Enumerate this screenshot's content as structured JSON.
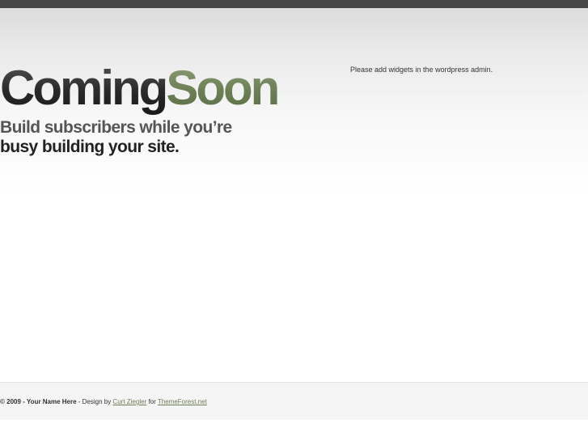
{
  "header": {
    "logo_part1": "Coming",
    "logo_part2": "Soon",
    "tagline_line1": "Build subscribers while you’re",
    "tagline_line2": "busy building your site."
  },
  "sidebar": {
    "widget_note": "Please add widgets in the wordpress admin."
  },
  "footer": {
    "copyright": "© 2009 - Your Name Here",
    "design_by_text": " - Design by ",
    "designer_link": "Curt Ziegler",
    "for_text": " for ",
    "themeforest_link": "ThemeForest.net"
  },
  "colors": {
    "top_bar": "#474747",
    "logo_dark": "#2a2a2a",
    "logo_green": "#6c7f55",
    "link": "#6b7d54"
  }
}
